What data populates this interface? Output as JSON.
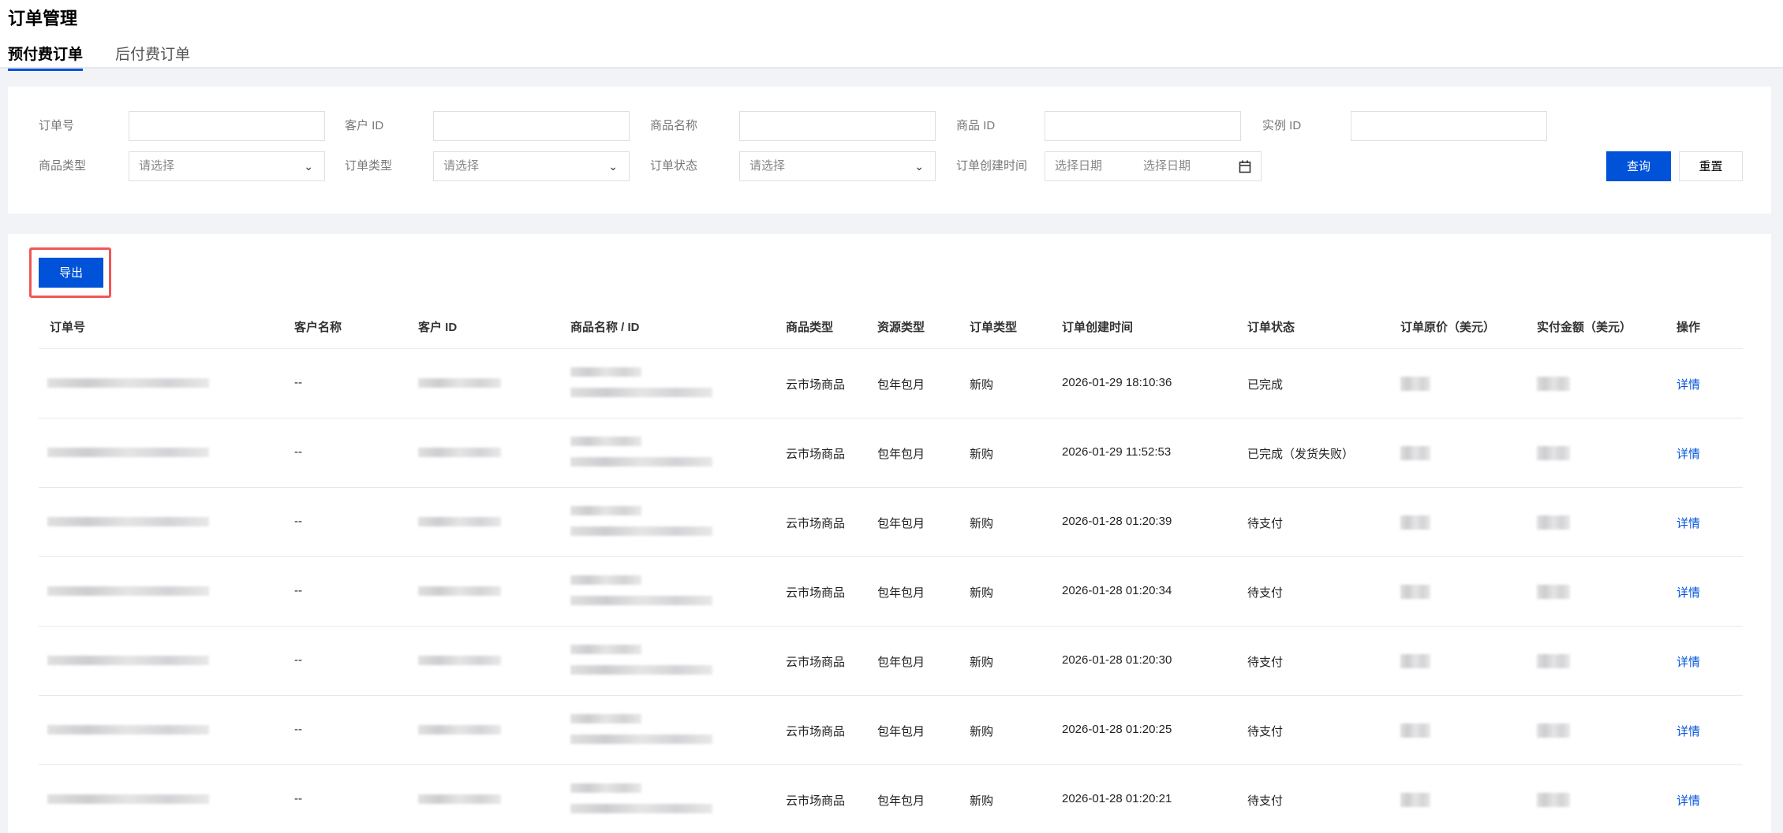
{
  "header": {
    "title": "订单管理",
    "tabs": [
      {
        "label": "预付费订单",
        "active": true
      },
      {
        "label": "后付费订单",
        "active": false
      }
    ]
  },
  "filters": {
    "order_no": {
      "label": "订单号",
      "value": ""
    },
    "customer_id": {
      "label": "客户 ID",
      "value": ""
    },
    "product_name": {
      "label": "商品名称",
      "value": ""
    },
    "product_id": {
      "label": "商品 ID",
      "value": ""
    },
    "instance_id": {
      "label": "实例 ID",
      "value": ""
    },
    "product_type": {
      "label": "商品类型",
      "placeholder": "请选择"
    },
    "order_type": {
      "label": "订单类型",
      "placeholder": "请选择"
    },
    "order_status": {
      "label": "订单状态",
      "placeholder": "请选择"
    },
    "created_time": {
      "label": "订单创建时间",
      "start_placeholder": "选择日期",
      "end_placeholder": "选择日期"
    },
    "query_label": "查询",
    "reset_label": "重置"
  },
  "export_label": "导出",
  "accent": "#0052d9",
  "table": {
    "columns": [
      "订单号",
      "客户名称",
      "客户 ID",
      "商品名称 / ID",
      "商品类型",
      "资源类型",
      "订单类型",
      "订单创建时间",
      "订单状态",
      "订单原价（美元）",
      "实付金额（美元）",
      "操作"
    ],
    "rows": [
      {
        "customer_name": "--",
        "product_type": "云市场商品",
        "resource_type": "包年包月",
        "order_type": "新购",
        "created": "2026-01-29 18:10:36",
        "status": "已完成",
        "action": "详情"
      },
      {
        "customer_name": "--",
        "product_type": "云市场商品",
        "resource_type": "包年包月",
        "order_type": "新购",
        "created": "2026-01-29 11:52:53",
        "status": "已完成（发货失败）",
        "action": "详情"
      },
      {
        "customer_name": "--",
        "product_type": "云市场商品",
        "resource_type": "包年包月",
        "order_type": "新购",
        "created": "2026-01-28 01:20:39",
        "status": "待支付",
        "action": "详情"
      },
      {
        "customer_name": "--",
        "product_type": "云市场商品",
        "resource_type": "包年包月",
        "order_type": "新购",
        "created": "2026-01-28 01:20:34",
        "status": "待支付",
        "action": "详情"
      },
      {
        "customer_name": "--",
        "product_type": "云市场商品",
        "resource_type": "包年包月",
        "order_type": "新购",
        "created": "2026-01-28 01:20:30",
        "status": "待支付",
        "action": "详情"
      },
      {
        "customer_name": "--",
        "product_type": "云市场商品",
        "resource_type": "包年包月",
        "order_type": "新购",
        "created": "2026-01-28 01:20:25",
        "status": "待支付",
        "action": "详情"
      },
      {
        "customer_name": "--",
        "product_type": "云市场商品",
        "resource_type": "包年包月",
        "order_type": "新购",
        "created": "2026-01-28 01:20:21",
        "status": "待支付",
        "action": "详情"
      }
    ]
  }
}
